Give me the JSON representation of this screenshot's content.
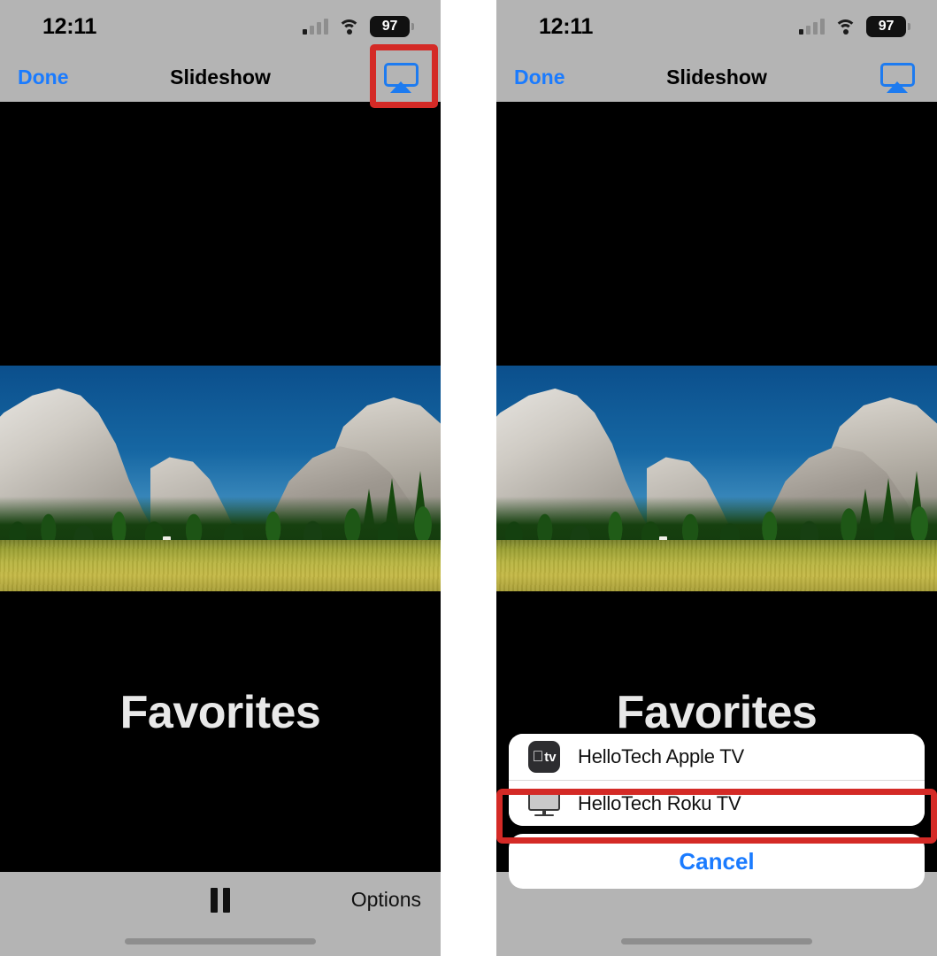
{
  "meta": {
    "scene": "iOS Photos slideshow AirPlay tutorial, two phone screenshots side by side",
    "accent_blue": "#1a7bff",
    "annotation_red": "#d42a26",
    "toolbar_grey": "#b4b4b4"
  },
  "status_bar": {
    "time": "12:11",
    "battery_percent": "97",
    "signal_icon": "cellular-signal-icon",
    "wifi_icon": "wifi-icon",
    "battery_icon": "battery-icon"
  },
  "nav_bar": {
    "done_label": "Done",
    "title": "Slideshow",
    "airplay_icon": "airplay-icon"
  },
  "slideshow": {
    "caption": "Favorites",
    "photo_alt": "Yosemite valley with El Capitan, pine forest and golden meadow"
  },
  "toolbar": {
    "pause_icon": "pause-icon",
    "options_label": "Options",
    "home_indicator": "home-indicator"
  },
  "airplay_sheet": {
    "devices": [
      {
        "name": "HelloTech Apple TV",
        "icon": "apple-tv-icon",
        "highlighted": true
      },
      {
        "name": "HelloTech Roku TV",
        "icon": "roku-tv-icon",
        "highlighted": false
      }
    ],
    "cancel_label": "Cancel"
  },
  "annotations": {
    "airplay_button_box": "red highlight around AirPlay button",
    "apple_tv_row_box": "red highlight around HelloTech Apple TV row"
  }
}
